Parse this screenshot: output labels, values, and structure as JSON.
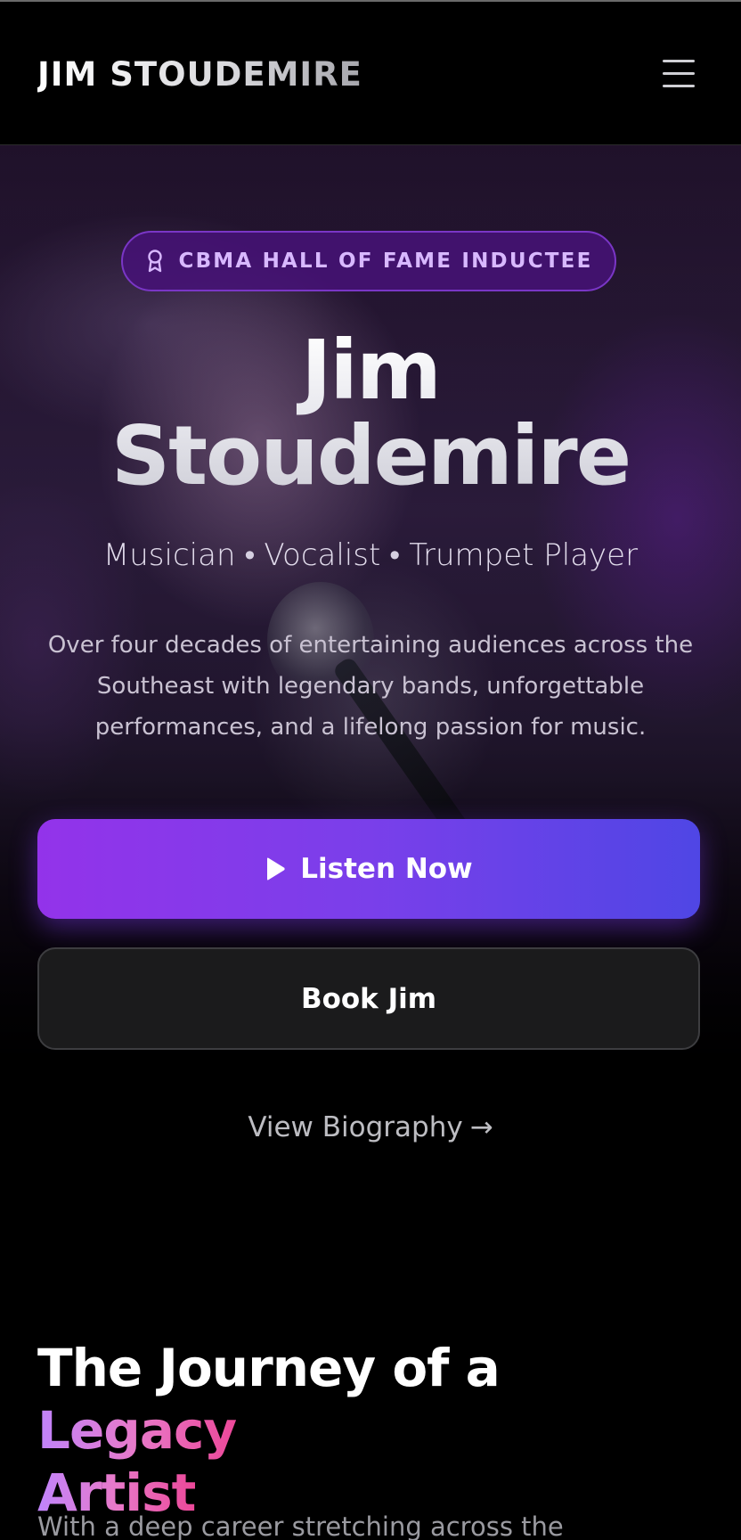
{
  "header": {
    "logo": "JIM STOUDEMIRE",
    "menu_icon": "hamburger-menu-icon"
  },
  "hero": {
    "badge": {
      "icon": "award-ribbon-icon",
      "label": "CBMA HALL OF FAME INDUCTEE"
    },
    "title_line1": "Jim",
    "title_line2": "Stoudemire",
    "roles": [
      "Musician",
      "Vocalist",
      "Trumpet Player"
    ],
    "role_separator": "•",
    "description": "Over four decades of entertaining audiences across the Southeast with legendary bands, unforgettable performances, and a lifelong passion for music.",
    "listen_button": {
      "icon": "play-icon",
      "label": "Listen Now"
    },
    "book_button": {
      "label": "Book Jim"
    },
    "bio_link": {
      "label": "View Biography",
      "arrow": "→"
    }
  },
  "journey": {
    "title_plain": "The Journey of a ",
    "title_accent_1": "Legacy",
    "title_accent_2": "Artist",
    "intro": "With a deep career stretching across the"
  },
  "colors": {
    "background": "#000000",
    "badge_bg": "#46127a",
    "badge_border": "#7a36c6",
    "badge_text": "#d8b8ff",
    "cta_gradient_start": "#9333ea",
    "cta_gradient_end": "#4f46e5",
    "accent_start": "#c084fc",
    "accent_end": "#ec4899"
  }
}
